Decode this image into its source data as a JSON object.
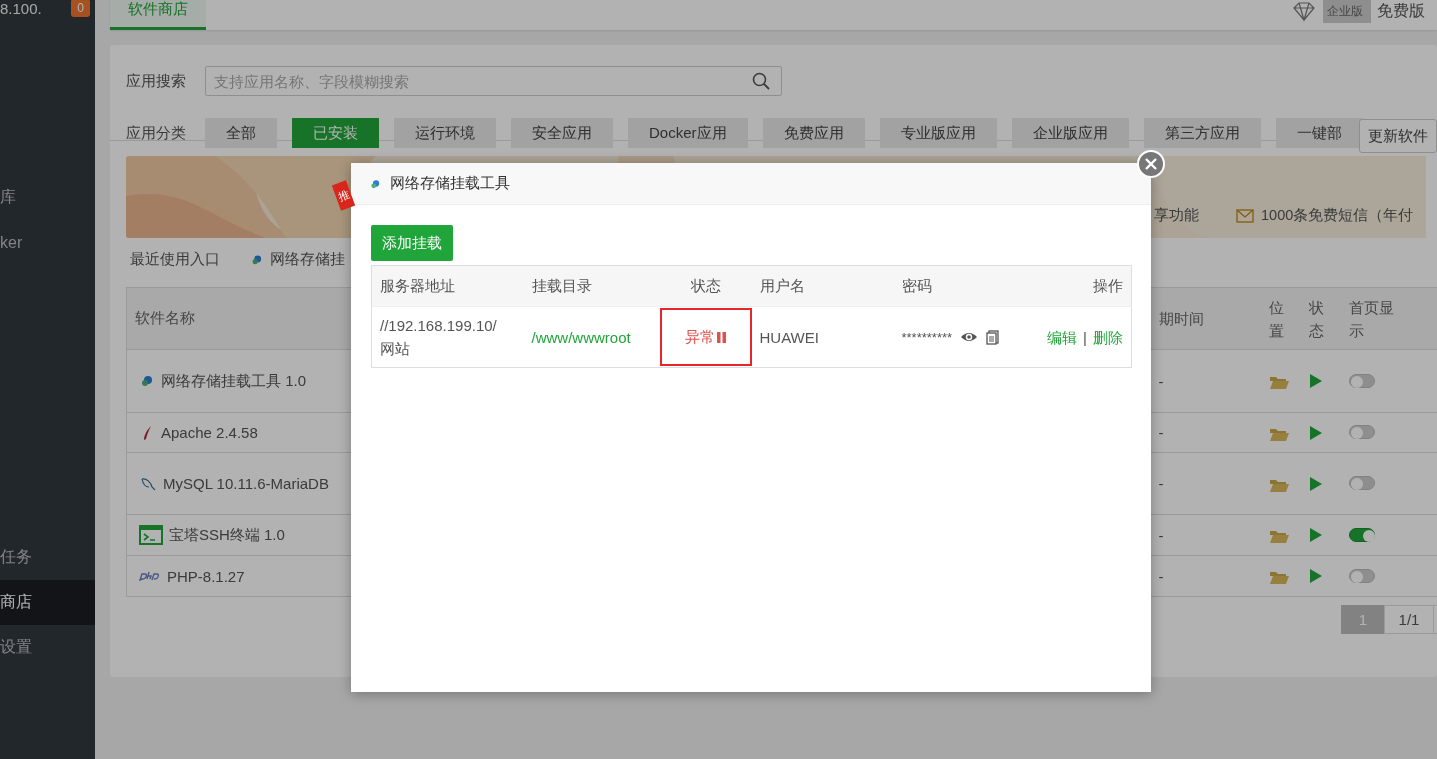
{
  "sidebar": {
    "host": "8.100.",
    "badge": "0",
    "items": [
      {
        "label": "库",
        "selected": false
      },
      {
        "label": "ker",
        "selected": false
      },
      {
        "label": "任务",
        "selected": false
      },
      {
        "label": "商店",
        "selected": true
      },
      {
        "label": "设置",
        "selected": false
      }
    ]
  },
  "topbar": {
    "tabs": [
      {
        "label": "软件商店",
        "selected": true
      }
    ],
    "edition_badge": "企业版",
    "edition": "免费版"
  },
  "search": {
    "label": "应用搜索",
    "placeholder": "支持应用名称、字段模糊搜索"
  },
  "categories": {
    "label": "应用分类",
    "items": [
      {
        "label": "全部",
        "selected": false
      },
      {
        "label": "已安装",
        "selected": true
      },
      {
        "label": "运行环境",
        "selected": false
      },
      {
        "label": "安全应用",
        "selected": false
      },
      {
        "label": "Docker应用",
        "selected": false
      },
      {
        "label": "免费应用",
        "selected": false
      },
      {
        "label": "专业版应用",
        "selected": false
      },
      {
        "label": "企业版应用",
        "selected": false
      },
      {
        "label": "第三方应用",
        "selected": false
      },
      {
        "label": "一键部",
        "selected": false
      }
    ],
    "update_button": "更新软件"
  },
  "banner": {
    "ribbon": "推",
    "features": [
      "享功能",
      "1000条免费短信（年付"
    ]
  },
  "recent": {
    "label": "最近使用入口",
    "items": [
      "网络存储挂"
    ]
  },
  "table": {
    "columns": [
      "软件名称",
      "期时间",
      "位置",
      "状态",
      "首页显示"
    ],
    "rows": [
      {
        "kind": "nas",
        "name": "网络存储挂载工具 1.0",
        "expiry": "-",
        "home_display": false
      },
      {
        "kind": "apache",
        "name": "Apache 2.4.58",
        "expiry": "-",
        "home_display": false
      },
      {
        "kind": "mysql",
        "name": "MySQL 10.11.6-MariaDB",
        "expiry": "-",
        "home_display": false
      },
      {
        "kind": "ssh",
        "name": "宝塔SSH终端 1.0",
        "expiry": "-",
        "home_display": true
      },
      {
        "kind": "php",
        "name": "PHP-8.1.27",
        "expiry": "-",
        "home_display": false
      }
    ]
  },
  "pagination": {
    "pages": [
      {
        "label": "1",
        "selected": true
      }
    ],
    "summary": "1/1"
  },
  "dialog": {
    "title": "网络存储挂载工具",
    "add_button": "添加挂载",
    "columns": [
      "服务器地址",
      "挂载目录",
      "状态",
      "用户名",
      "密码",
      "操作"
    ],
    "rows": [
      {
        "server": "//192.168.199.10/网站",
        "directory": "/www/wwwroot",
        "status": "异常",
        "abnormal": true,
        "highlighted": true,
        "username": "HUAWEI",
        "password": "**********",
        "actions": [
          "编辑",
          "删除"
        ],
        "action_separator": "|"
      }
    ]
  }
}
